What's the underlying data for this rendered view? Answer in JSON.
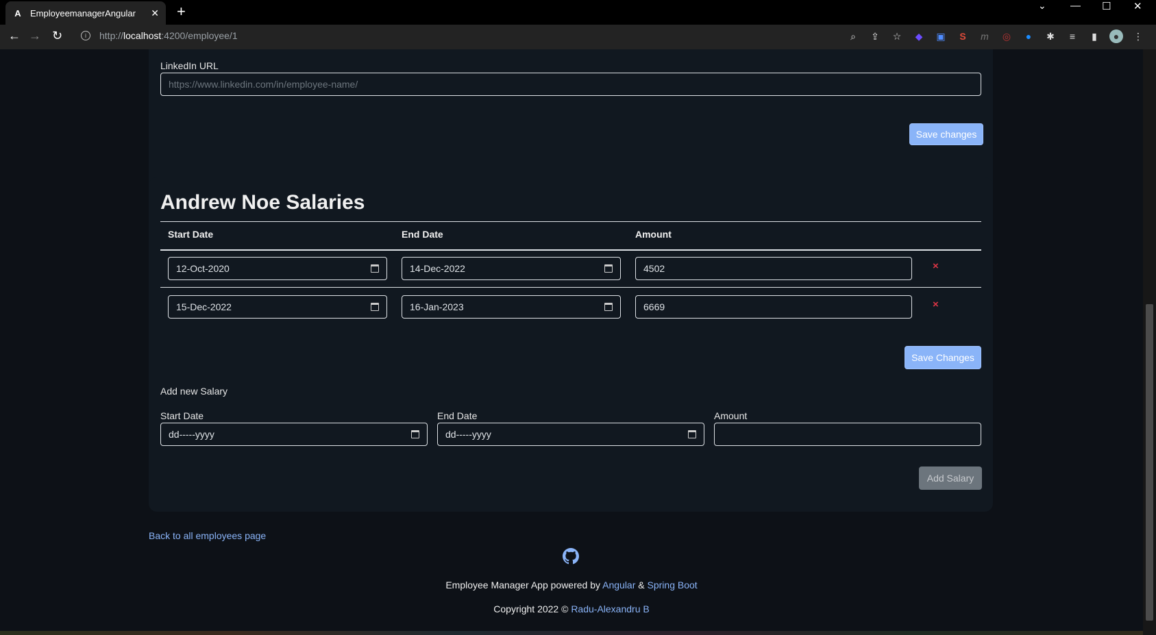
{
  "browser": {
    "tab_title": "EmployeemanagerAngular",
    "url_prefix": "http://",
    "url_host": "localhost",
    "url_rest": ":4200/employee/1"
  },
  "linkedin": {
    "label": "LinkedIn URL",
    "placeholder": "https://www.linkedin.com/in/employee-name/",
    "save_label": "Save changes"
  },
  "salaries": {
    "title": "Andrew Noe Salaries",
    "headers": [
      "Start Date",
      "End Date",
      "Amount"
    ],
    "rows": [
      {
        "start": "12-Oct-2020",
        "end": "14-Dec-2022",
        "amount": "4502",
        "delete": "×"
      },
      {
        "start": "15-Dec-2022",
        "end": "16-Jan-2023",
        "amount": "6669",
        "delete": "×"
      }
    ],
    "save_label": "Save Changes"
  },
  "add_salary": {
    "heading": "Add new Salary",
    "start_label": "Start Date",
    "end_label": "End Date",
    "amount_label": "Amount",
    "date_placeholder": "dd-----yyyy",
    "button_label": "Add Salary"
  },
  "back_link": "Back to all employees page",
  "footer": {
    "line1_prefix": "Employee Manager App powered by ",
    "angular": "Angular",
    "amp": " & ",
    "spring": "Spring Boot",
    "copyright_prefix": "Copyright 2022 © ",
    "author": "Radu-Alexandru B"
  },
  "colors": {
    "page_bg": "#0d1117",
    "card_bg": "#111820",
    "link": "#8ab4f8",
    "primary_button": "#8ab4f8",
    "delete": "#dc3545"
  }
}
